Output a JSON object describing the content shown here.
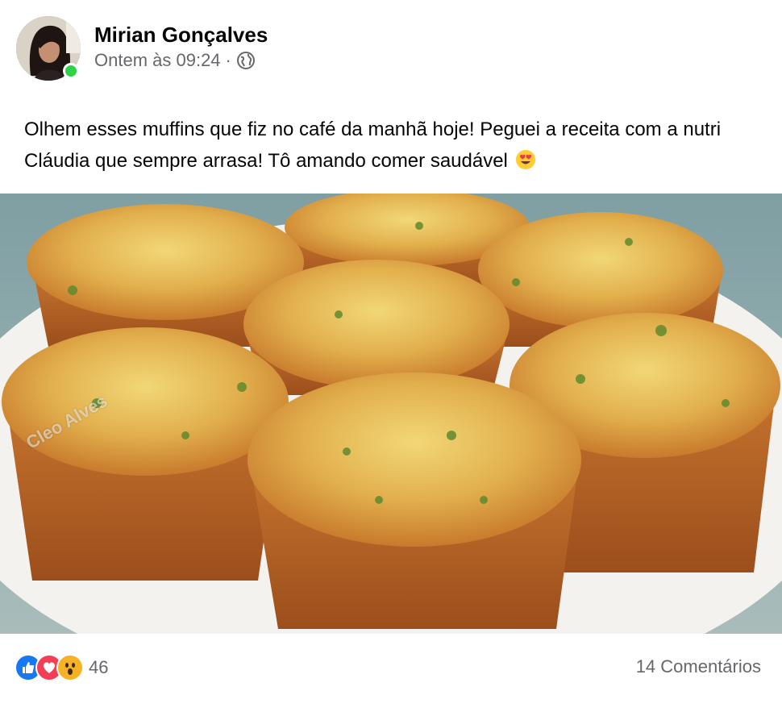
{
  "author": {
    "name": "Mirian Gonçalves",
    "online": true,
    "avatar": "profile-photo"
  },
  "meta": {
    "timestamp": "Ontem às 09:24",
    "separator": "·",
    "audience_icon": "globe-icon"
  },
  "post": {
    "text": "Olhem esses muffins que fiz no café da manhã hoje! Peguei a receita com a nutri Cláudia que sempre arrasa! Tô amando comer saudável",
    "emoji": "smiling-face-with-heart-eyes"
  },
  "photo": {
    "subject": "muffins",
    "watermark": "Cleo Alves"
  },
  "footer": {
    "reactions": [
      "like-icon",
      "love-icon",
      "wow-icon"
    ],
    "reaction_count": "46",
    "comments": "14 Comentários"
  },
  "colors": {
    "name": "#050505",
    "secondary_text": "#65676b",
    "online": "#31d249",
    "like": "#1877f2",
    "love": "#f33e58",
    "wow": "#f7b125"
  }
}
